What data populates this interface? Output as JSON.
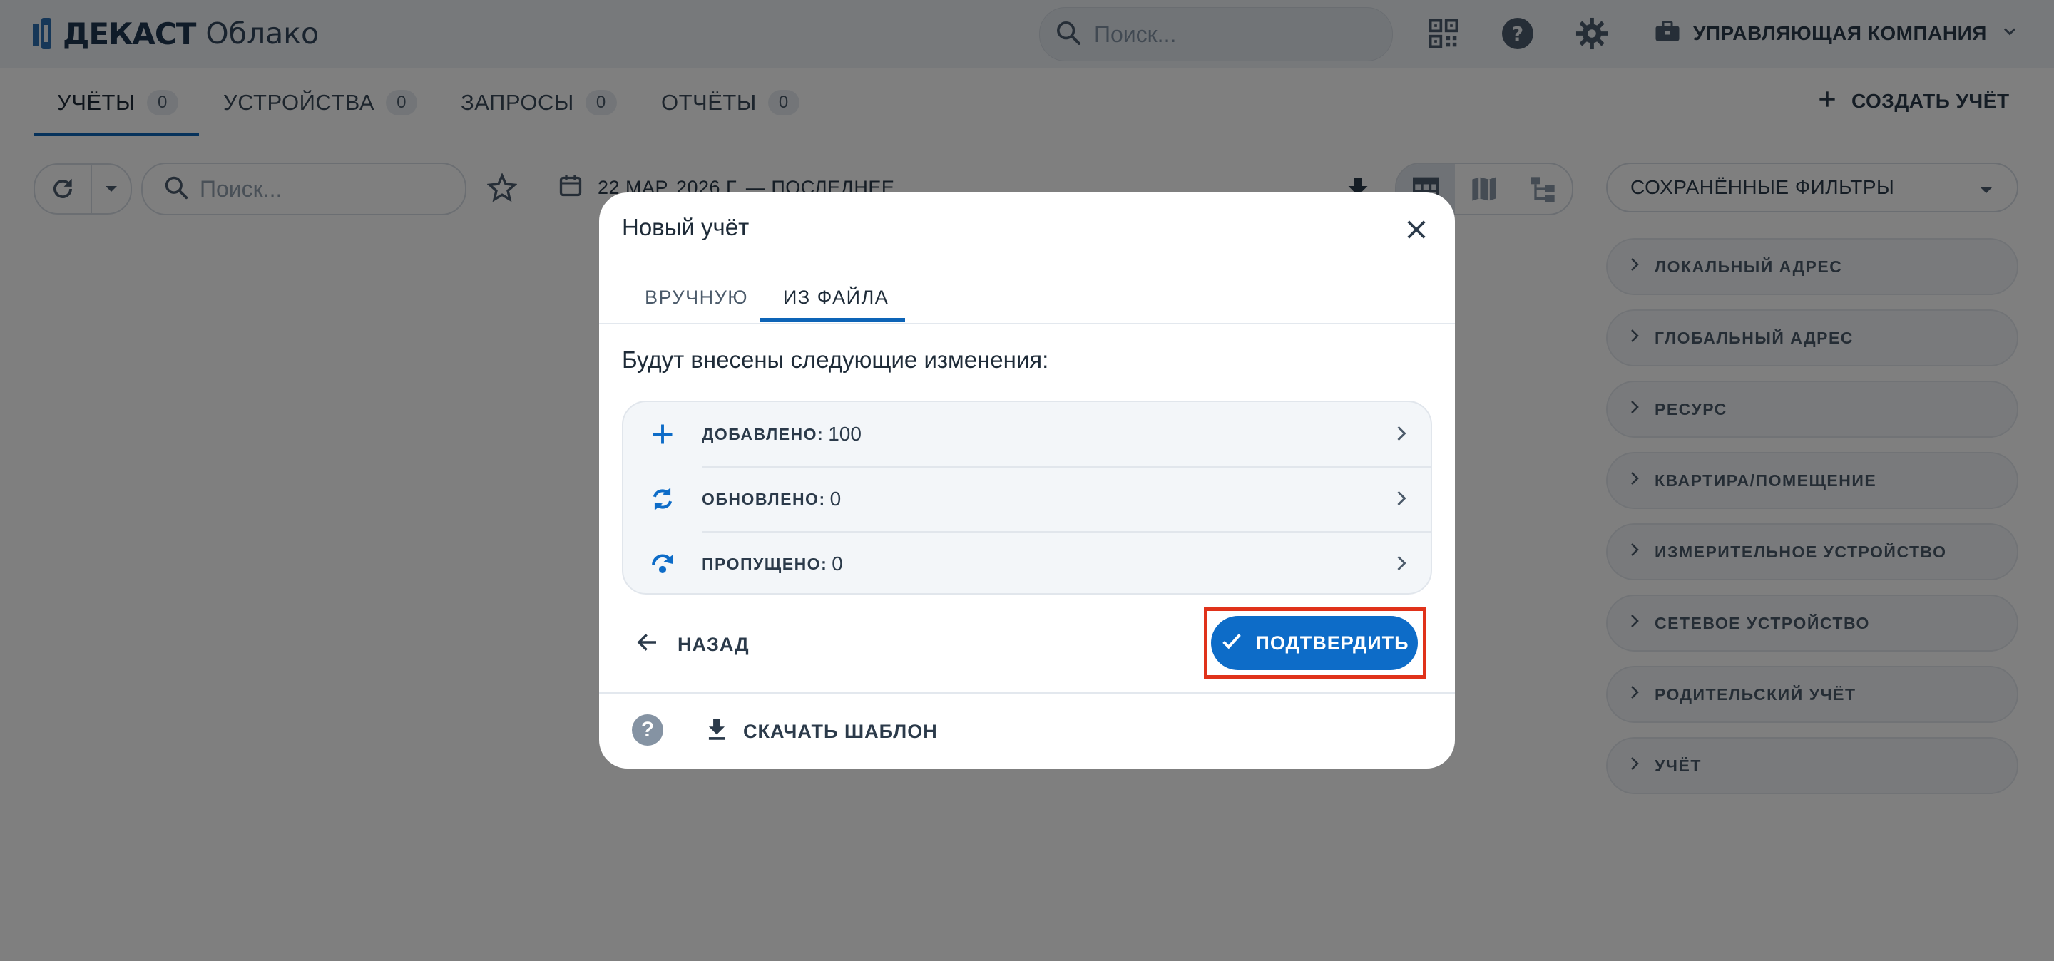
{
  "app": {
    "logo_bold": "ДЕКАСТ",
    "logo_light": "Облако"
  },
  "topbar": {
    "search_placeholder": "Поиск...",
    "company": "УПРАВЛЯЮЩАЯ КОМПАНИЯ"
  },
  "tabs": [
    {
      "label": "УЧЁТЫ",
      "count": "0"
    },
    {
      "label": "УСТРОЙСТВА",
      "count": "0"
    },
    {
      "label": "ЗАПРОСЫ",
      "count": "0"
    },
    {
      "label": "ОТЧЁТЫ",
      "count": "0"
    }
  ],
  "create_button": "СОЗДАТЬ УЧЁТ",
  "toolbar": {
    "search_placeholder": "Поиск...",
    "date_range": "22 МАР. 2026 Г. — ПОСЛЕДНЕЕ"
  },
  "filters": {
    "saved_label": "СОХРАНЁННЫЕ ФИЛЬТРЫ",
    "items": [
      "ЛОКАЛЬНЫЙ АДРЕС",
      "ГЛОБАЛЬНЫЙ АДРЕС",
      "РЕСУРС",
      "КВАРТИРА/ПОМЕЩЕНИЕ",
      "ИЗМЕРИТЕЛЬНОЕ УСТРОЙСТВО",
      "СЕТЕВОЕ УСТРОЙСТВО",
      "РОДИТЕЛЬСКИЙ УЧЁТ",
      "УЧЁТ"
    ]
  },
  "dialog": {
    "title": "Новый учёт",
    "tabs": [
      "ВРУЧНУЮ",
      "ИЗ ФАЙЛА"
    ],
    "active_tab": "ИЗ ФАЙЛА",
    "subtitle": "Будут внесены следующие изменения:",
    "changes": [
      {
        "label": "ДОБАВЛЕНО:",
        "value": "100",
        "icon": "plus-icon"
      },
      {
        "label": "ОБНОВЛЕНО:",
        "value": "0",
        "icon": "sync-icon"
      },
      {
        "label": "ПРОПУЩЕНО:",
        "value": "0",
        "icon": "skip-icon"
      }
    ],
    "back_label": "НАЗАД",
    "confirm_label": "ПОДТВЕРДИТЬ",
    "download_template": "СКАЧАТЬ ШАБЛОН"
  },
  "colors": {
    "accent": "#0d6cc8",
    "highlight": "#e0321a"
  }
}
